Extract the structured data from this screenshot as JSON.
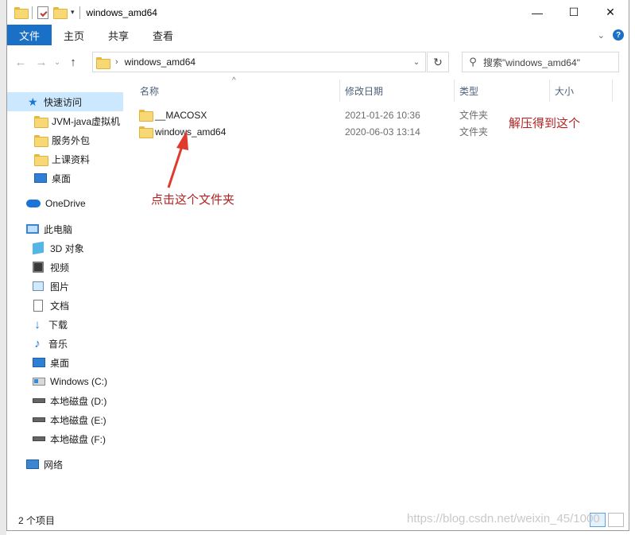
{
  "window": {
    "title": "windows_amd64"
  },
  "ribbon": {
    "tabs": [
      "文件",
      "主页",
      "共享",
      "查看"
    ]
  },
  "address": {
    "path": "windows_amd64",
    "separator": "›"
  },
  "search": {
    "placeholder": "搜索\"windows_amd64\""
  },
  "sidebar": {
    "quick_access": "快速访问",
    "pinned": [
      "JVM-java虚拟机",
      "服务外包",
      "上课资料",
      "桌面"
    ],
    "onedrive": "OneDrive",
    "this_pc": "此电脑",
    "pc_items": [
      "3D 对象",
      "视频",
      "图片",
      "文档",
      "下载",
      "音乐",
      "桌面",
      "Windows (C:)",
      "本地磁盘 (D:)",
      "本地磁盘 (E:)",
      "本地磁盘 (F:)"
    ],
    "network": "网络"
  },
  "columns": {
    "name": "名称",
    "modified": "修改日期",
    "type": "类型",
    "size": "大小"
  },
  "files": [
    {
      "name": "__MACOSX",
      "modified": "2021-01-26 10:36",
      "type": "文件夹"
    },
    {
      "name": "windows_amd64",
      "modified": "2020-06-03 13:14",
      "type": "文件夹"
    }
  ],
  "annotations": {
    "extracted": "解压得到这个",
    "click_folder": "点击这个文件夹"
  },
  "status": {
    "count": "2 个项目"
  },
  "watermark": "https://blog.csdn.net/weixin_45/1000",
  "colors": {
    "accent": "#1a6fc6",
    "selection": "#cce8ff",
    "annotation": "#b22222",
    "folder": "#f8d775"
  }
}
